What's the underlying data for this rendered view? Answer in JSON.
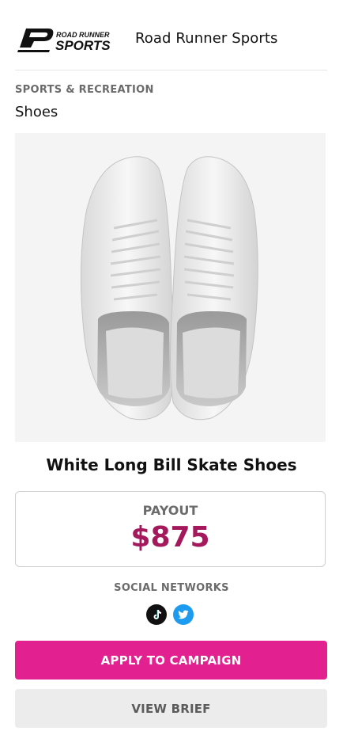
{
  "brand": {
    "logo_text_top": "ROAD RUNNER",
    "logo_text_bottom": "SPORTS",
    "name": "Road Runner Sports"
  },
  "category": "SPORTS & RECREATION",
  "subcategory": "Shoes",
  "product": {
    "title": "White Long Bill Skate Shoes"
  },
  "payout": {
    "label": "PAYOUT",
    "value": "$875"
  },
  "social": {
    "label": "SOCIAL NETWORKS",
    "networks": [
      "tiktok-icon",
      "twitter-icon"
    ]
  },
  "buttons": {
    "apply": "APPLY TO CAMPAIGN",
    "brief": "VIEW BRIEF"
  },
  "colors": {
    "accent": "#e3208f",
    "payout": "#a3195b",
    "twitter": "#1d9bf0"
  }
}
